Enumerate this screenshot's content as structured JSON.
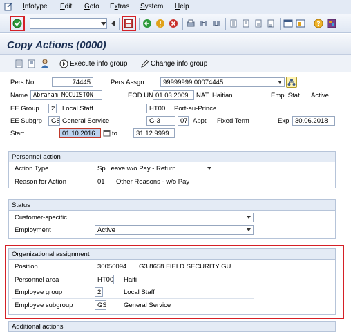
{
  "menubar": {
    "items": [
      "Infotype",
      "Edit",
      "Goto",
      "Extras",
      "System",
      "Help"
    ],
    "underlines": [
      "I",
      "E",
      "G",
      "x",
      "S",
      "H"
    ]
  },
  "title": "Copy Actions (0000)",
  "app_toolbar": {
    "execute_label": "Execute info group",
    "change_label": "Change info group"
  },
  "header": {
    "pers_no_label": "Pers.No.",
    "pers_no": "74445",
    "pers_assgn_label": "Pers.Assgn",
    "pers_assgn": "99999999 00074445",
    "name_label": "Name",
    "name": "Abraham MCCUISTON",
    "eod_label": "EOD UN",
    "eod": "01.03.2009",
    "nat_label": "NAT",
    "nat": "Haitian",
    "emp_stat_label": "Emp. Stat",
    "emp_stat": "Active",
    "ee_group_label": "EE Group",
    "ee_group_code": "2",
    "ee_group_text": "Local Staff",
    "pers_area_code": "HT00",
    "pers_area_text": "Port-au-Prince",
    "ee_subgrp_label": "EE Subgrp",
    "ee_subgrp_code": "GS",
    "ee_subgrp_text": "General Service",
    "grade": "G-3",
    "step": "07",
    "appt_label": "Appt",
    "appt": "Fixed Term",
    "exp_label": "Exp",
    "exp": "30.06.2018",
    "start_label": "Start",
    "start": "01.10.2016",
    "to_label": "to",
    "end": "31.12.9999"
  },
  "personnel_action": {
    "heading": "Personnel action",
    "action_type_label": "Action Type",
    "action_type": "Sp Leave w/o Pay - Return",
    "reason_label": "Reason for Action",
    "reason_code": "01",
    "reason_text": "Other Reasons - w/o Pay"
  },
  "status": {
    "heading": "Status",
    "customer_label": "Customer-specific",
    "customer_value": "",
    "employment_label": "Employment",
    "employment_value": "Active"
  },
  "org_assignment": {
    "heading": "Organizational assignment",
    "position_label": "Position",
    "position_code": "30056094",
    "position_text": "G3 8658 FIELD SECURITY GU",
    "pers_area_label": "Personnel area",
    "pers_area_code": "HT00",
    "pers_area_text": "Haiti",
    "emp_group_label": "Employee group",
    "emp_group_code": "2",
    "emp_group_text": "Local Staff",
    "emp_subgroup_label": "Employee subgroup",
    "emp_subgroup_code": "GS",
    "emp_subgroup_text": "General Service"
  },
  "additional": {
    "heading": "Additional actions"
  },
  "colors": {
    "highlight": "#d52027",
    "accent": "#1b2f52"
  }
}
